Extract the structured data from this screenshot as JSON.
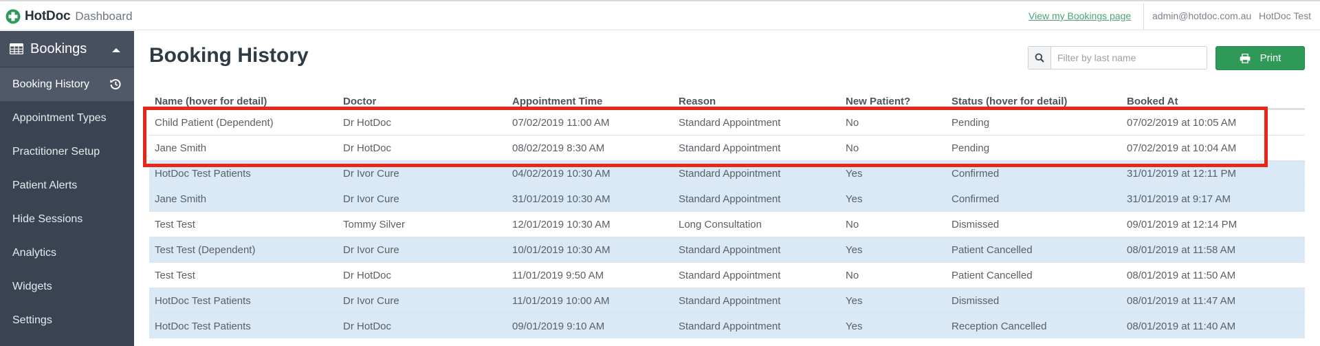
{
  "brand": {
    "name": "HotDoc",
    "subtitle": "Dashboard"
  },
  "topbar": {
    "bookings_link": "View my Bookings page",
    "email": "admin@hotdoc.com.au",
    "org": "HotDoc Test"
  },
  "sidebar": {
    "section_label": "Bookings",
    "items": [
      {
        "label": "Booking History",
        "active": true
      },
      {
        "label": "Appointment Types"
      },
      {
        "label": "Practitioner Setup"
      },
      {
        "label": "Patient Alerts"
      },
      {
        "label": "Hide Sessions"
      },
      {
        "label": "Analytics"
      },
      {
        "label": "Widgets"
      },
      {
        "label": "Settings"
      }
    ]
  },
  "main": {
    "title": "Booking History",
    "search_placeholder": "Filter by last name",
    "print_label": "Print"
  },
  "table": {
    "columns": [
      "Name (hover for detail)",
      "Doctor",
      "Appointment Time",
      "Reason",
      "New Patient?",
      "Status (hover for detail)",
      "Booked At"
    ],
    "rows": [
      [
        "Child Patient (Dependent)",
        "Dr HotDoc",
        "07/02/2019 11:00 AM",
        "Standard Appointment",
        "No",
        "Pending",
        "07/02/2019 at 10:05 AM"
      ],
      [
        "Jane Smith",
        "Dr HotDoc",
        "08/02/2019 8:30 AM",
        "Standard Appointment",
        "No",
        "Pending",
        "07/02/2019 at 10:04 AM"
      ],
      [
        "HotDoc Test Patients",
        "Dr Ivor Cure",
        "04/02/2019 10:30 AM",
        "Standard Appointment",
        "Yes",
        "Confirmed",
        "31/01/2019 at 12:11 PM"
      ],
      [
        "Jane Smith",
        "Dr Ivor Cure",
        "31/01/2019 10:30 AM",
        "Standard Appointment",
        "Yes",
        "Confirmed",
        "31/01/2019 at 9:17 AM"
      ],
      [
        "Test Test",
        "Tommy Silver",
        "12/01/2019 10:30 AM",
        "Long Consultation",
        "No",
        "Dismissed",
        "09/01/2019 at 12:14 PM"
      ],
      [
        "Test Test (Dependent)",
        "Dr Ivor Cure",
        "10/01/2019 10:30 AM",
        "Standard Appointment",
        "Yes",
        "Patient Cancelled",
        "08/01/2019 at 11:58 AM"
      ],
      [
        "Test Test",
        "Dr HotDoc",
        "11/01/2019 9:50 AM",
        "Standard Appointment",
        "No",
        "Patient Cancelled",
        "08/01/2019 at 11:50 AM"
      ],
      [
        "HotDoc Test Patients",
        "Dr Ivor Cure",
        "11/01/2019 10:00 AM",
        "Standard Appointment",
        "Yes",
        "Dismissed",
        "08/01/2019 at 11:47 AM"
      ],
      [
        "HotDoc Test Patients",
        "Dr HotDoc",
        "09/01/2019 9:10 AM",
        "Standard Appointment",
        "Yes",
        "Reception Cancelled",
        "08/01/2019 at 11:40 AM"
      ]
    ],
    "row_shading": [
      "white",
      "white",
      "blue",
      "blue",
      "white",
      "blue",
      "white",
      "blue",
      "blue"
    ]
  },
  "colors": {
    "accent_green": "#2f9a58",
    "sidebar_bg": "#3a4352",
    "row_highlight": "#d9e9f5",
    "annotation_red": "#e8261a"
  }
}
